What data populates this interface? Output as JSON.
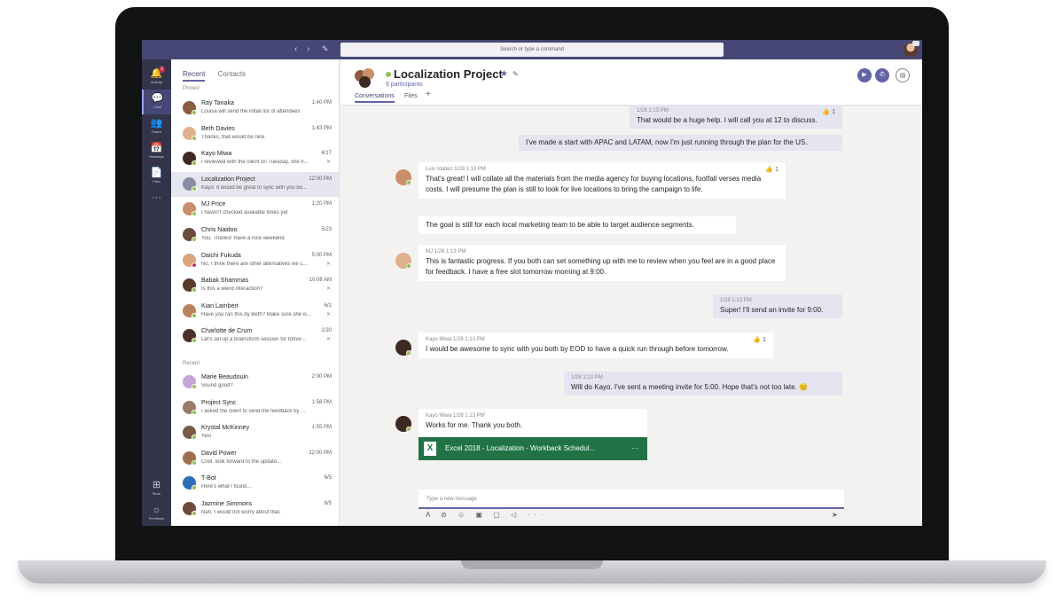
{
  "topbar": {
    "back_icon": "‹",
    "forward_icon": "›",
    "compose_icon": "✎",
    "search_placeholder": "Search or type a command"
  },
  "rail": [
    {
      "label": "Activity",
      "icon": "🔔",
      "badge": "2"
    },
    {
      "label": "Chat",
      "icon": "💬"
    },
    {
      "label": "Teams",
      "icon": "👥"
    },
    {
      "label": "Meetings",
      "icon": "📅"
    },
    {
      "label": "Files",
      "icon": "📄"
    },
    {
      "label": "",
      "icon": "···"
    },
    {
      "label": "Store",
      "icon": "⊞"
    },
    {
      "label": "Feedback",
      "icon": "☼"
    }
  ],
  "chatlist": {
    "tabs": [
      "Recent",
      "Contacts"
    ],
    "pinned_label": "Pinned",
    "recent_label": "Recent",
    "pinned": [
      {
        "name": "Ray Tanaka",
        "preview": "Louisa will send the initial list of attendees",
        "time": "1:40 PM"
      },
      {
        "name": "Beth Davies",
        "preview": "Thanks, that would be nice.",
        "time": "1:43 PM"
      },
      {
        "name": "Kayo Miwa",
        "preview": "I reviewed with the client on Tuesday, she h...",
        "time": "4/17"
      },
      {
        "name": "Localization Project",
        "preview": "Kayo: It would be great to sync with you bo...",
        "time": "12:00 PM"
      },
      {
        "name": "MJ Price",
        "preview": "I haven't checked available times yet",
        "time": "1:20 PM"
      },
      {
        "name": "Chris Naidoo",
        "preview": "You: Thanks! Have a nice weekend",
        "time": "5/23"
      },
      {
        "name": "Daichi Fukuda",
        "preview": "No, I think there are other alternatives we c...",
        "time": "5:00 PM"
      },
      {
        "name": "Babak Shammas",
        "preview": "Is this a weird interaction?",
        "time": "10:08 AM"
      },
      {
        "name": "Kian Lambert",
        "preview": "Have you ran this by Beth? Make sure she is...",
        "time": "6/2"
      },
      {
        "name": "Charlotte de Crum",
        "preview": "Let's set up a brainstorm session for tomor...",
        "time": "1/30"
      }
    ],
    "recent": [
      {
        "name": "Marie Beaudouin",
        "preview": "Sound good?",
        "time": "2:00 PM"
      },
      {
        "name": "Project Sync",
        "preview": "I asked the client to send the feedback by ...",
        "time": "1:58 PM"
      },
      {
        "name": "Krystal McKinney",
        "preview": "Yes!",
        "time": "1:55 PM"
      },
      {
        "name": "David Power",
        "preview": "Cool. look forward to the update...",
        "time": "12:00 PM"
      },
      {
        "name": "T-Bot",
        "preview": "Here's what I found...",
        "time": "6/5"
      },
      {
        "name": "Jazmine Simmons",
        "preview": "Nah. I would not worry about that.",
        "time": "6/5"
      }
    ]
  },
  "channel": {
    "title": "Localization Project",
    "participants": "6 participants",
    "tabs": [
      "Conversations",
      "Files"
    ],
    "add_tab": "+"
  },
  "messages": [
    {
      "meta": "1/28 1:13 PM",
      "text": "That would be a huge help. I will call you at 12 to discuss.",
      "likes": "1"
    },
    {
      "text": "I've made a start with APAC and LATAM, now I'm just running through the plan for the US."
    },
    {
      "meta": "Luis Valdez    1/28 1:13 PM",
      "text": "That's great! I will collate all the materials from the media agency for buying locations, footfall verses media costs. I will presume the plan is still to look for live locations to bring the campaign to life.",
      "likes": "1"
    },
    {
      "text": "The goal is still for each local marketing team to be able to target audience segments."
    },
    {
      "meta": "MJ    1/28 1:13 PM",
      "text": "This is fantastic progress. If you both can set something up with me to review when you feel are in a good place for feedback. I have a free slot tomorrow morning at 9:00."
    },
    {
      "meta": "1/28 1:13 PM",
      "text": "Super! I'll send an invite for 9:00."
    },
    {
      "meta": "Kayo Miwa    1/28 1:13 PM",
      "text": "I would be awesome to sync with you both by EOD to have a quick run through before tomorrow.",
      "likes": "1"
    },
    {
      "meta": "1/28 1:13 PM",
      "text": "Will do Kayo. I've sent a meeting invite for 5:00. Hope that's not too late. 😊"
    },
    {
      "meta": "Kayo Miwa    1/28 1:13 PM",
      "text": "Works for me. Thank you both."
    }
  ],
  "attachment": {
    "icon": "X",
    "name": "Excel 2018 - Localization - Workback Schedul...",
    "more": "···"
  },
  "compose": {
    "placeholder": "Type a new message",
    "tools": "A ⊘ ☺ ▣ ▢ ◁ ···",
    "send": "➤"
  },
  "colors": {
    "brand": "#464775",
    "accent": "#6264a7",
    "excel": "#217346",
    "presence": "#92c353"
  }
}
